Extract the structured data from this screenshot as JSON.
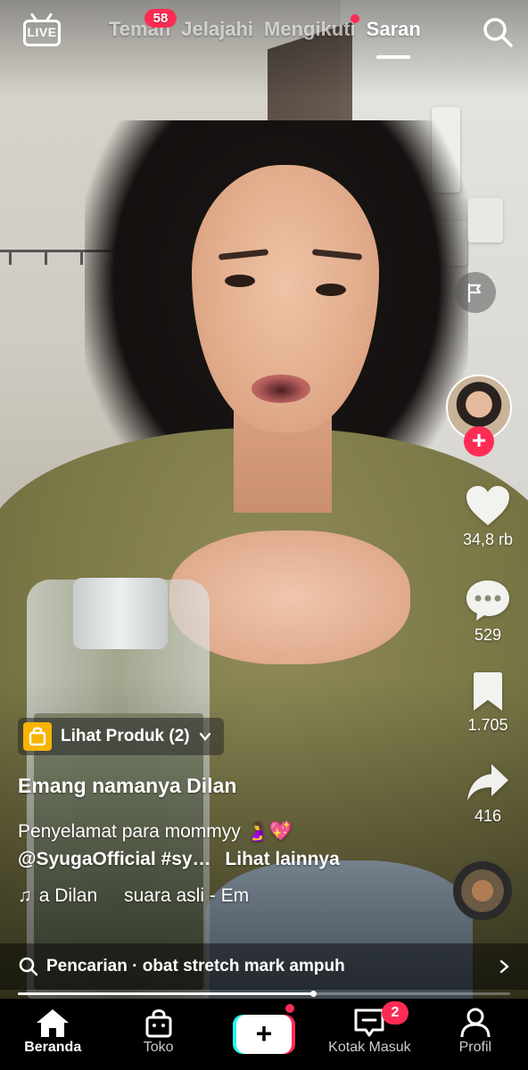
{
  "top_bar": {
    "live_label": "LIVE",
    "tabs": [
      {
        "label": "Teman",
        "badge": "58"
      },
      {
        "label": "Jelajahi"
      },
      {
        "label": "Mengikuti",
        "dot": true
      },
      {
        "label": "Saran",
        "active": true
      }
    ]
  },
  "actions": {
    "likes": "34,8 rb",
    "comments": "529",
    "saves": "1.705",
    "shares": "416"
  },
  "post": {
    "product_chip": "Lihat Produk (2)",
    "author": "Emang namanya Dilan",
    "caption_line1": "Penyelamat para mommyy 🤰💖",
    "caption_tags": "@SyugaOfficial #sy…",
    "see_more": "Lihat lainnya",
    "sound_note": "♫",
    "sound_text": "a Dilan",
    "sound_original": "suara asli - Em"
  },
  "search_suggestion": {
    "text": "Pencarian · obat stretch mark ampuh"
  },
  "playback": {
    "progress_fraction": 0.6
  },
  "bottom_nav": {
    "items": [
      {
        "label": "Beranda",
        "active": true
      },
      {
        "label": "Toko",
        "dot": true
      },
      {
        "label": ""
      },
      {
        "label": "Kotak Masuk",
        "badge": "2"
      },
      {
        "label": "Profil"
      }
    ]
  },
  "colors": {
    "accent_red": "#fe2c55",
    "accent_cyan": "#25f4ee",
    "bag_yellow": "#f8b400"
  }
}
